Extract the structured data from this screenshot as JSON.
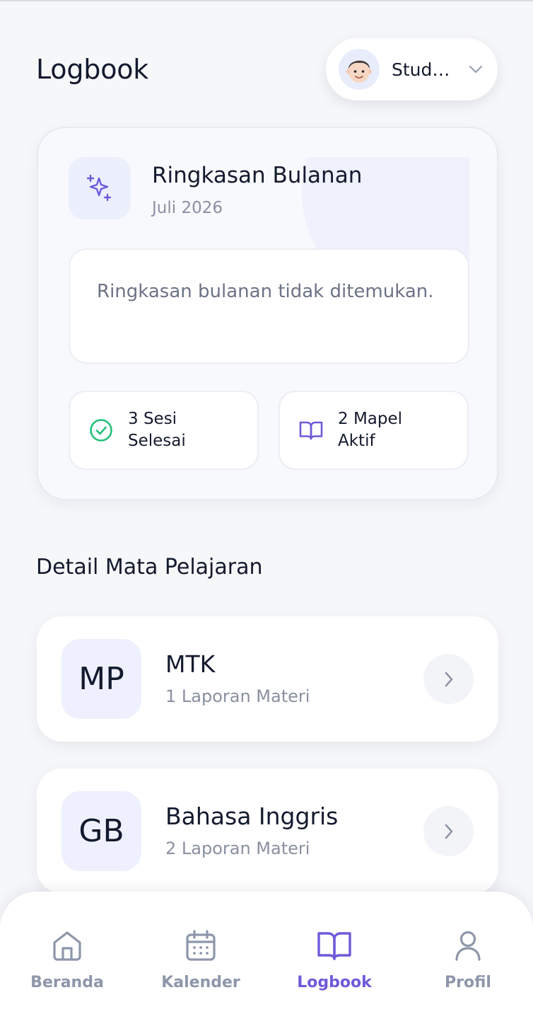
{
  "header": {
    "title": "Logbook",
    "user_name": "Stude...",
    "avatar_icon": "boy-avatar-icon",
    "dropdown_icon": "chevron-down-icon"
  },
  "summary": {
    "icon": "sparkle-icon",
    "title": "Ringkasan Bulanan",
    "month": "Juli 2026",
    "empty_message": "Ringkasan bulanan tidak ditemukan.",
    "stats": [
      {
        "icon": "check-circle-icon",
        "line1": "3 Sesi",
        "line2": "Selesai",
        "color": "#22c07a"
      },
      {
        "icon": "book-open-icon",
        "line1": "2 Mapel",
        "line2": "Aktif",
        "color": "#6d5bd9"
      }
    ]
  },
  "subjects_section": {
    "title": "Detail Mata Pelajaran",
    "items": [
      {
        "badge": "MP",
        "name": "MTK",
        "meta": "1 Laporan Materi"
      },
      {
        "badge": "GB",
        "name": "Bahasa Inggris",
        "meta": "2 Laporan Materi"
      }
    ]
  },
  "bottom_nav": {
    "items": [
      {
        "label": "Beranda",
        "icon": "home-icon",
        "active": false
      },
      {
        "label": "Kalender",
        "icon": "calendar-icon",
        "active": false
      },
      {
        "label": "Logbook",
        "icon": "book-open-icon",
        "active": true
      },
      {
        "label": "Profil",
        "icon": "user-icon",
        "active": false
      }
    ]
  },
  "colors": {
    "accent": "#6d5bd9",
    "success": "#22c07a",
    "muted": "#8e96aa",
    "text": "#141a2e",
    "background": "#f6f7f9"
  }
}
